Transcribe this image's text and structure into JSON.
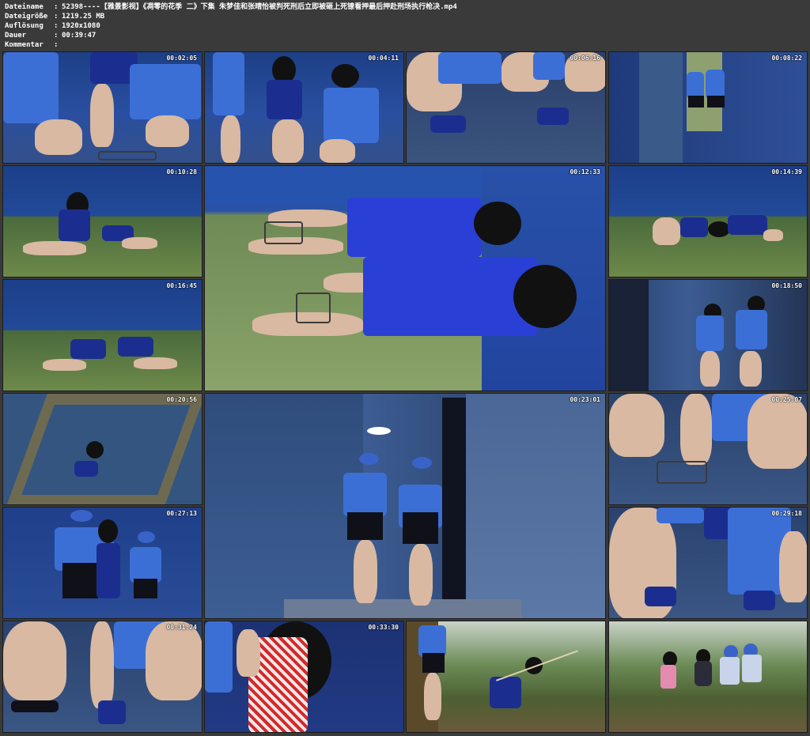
{
  "header": {
    "rows": [
      {
        "label": "Dateiname",
        "value": "52398----【雅景影视】《凋零的花季 二》下集 朱梦佳和张晴怡被判死刑后立即被砸上死镣看押最后押赴刑场执行枪决.mp4"
      },
      {
        "label": "Dateigröße",
        "value": "1219.25 MB"
      },
      {
        "label": "Auflösung",
        "value": "1920x1080"
      },
      {
        "label": "Dauer",
        "value": "00:39:47"
      },
      {
        "label": "Kommentar",
        "value": ""
      }
    ]
  },
  "thumbnails": [
    {
      "time": "00:02:05"
    },
    {
      "time": "00:04:11"
    },
    {
      "time": "00:06:16"
    },
    {
      "time": "00:08:22"
    },
    {
      "time": "00:10:28"
    },
    {
      "time": "00:12:33"
    },
    {
      "time": "00:14:39"
    },
    {
      "time": "00:16:45"
    },
    {
      "time": "00:18:50"
    },
    {
      "time": "00:20:56"
    },
    {
      "time": "00:23:01"
    },
    {
      "time": "00:25:07"
    },
    {
      "time": "00:27:13"
    },
    {
      "time": "00:29:18"
    },
    {
      "time": "00:31:24"
    },
    {
      "time": "00:33:30"
    }
  ],
  "colors": {
    "background": "#3a3a3a",
    "header_text": "#ffffff",
    "scene_blue": "#2a4fa0"
  }
}
